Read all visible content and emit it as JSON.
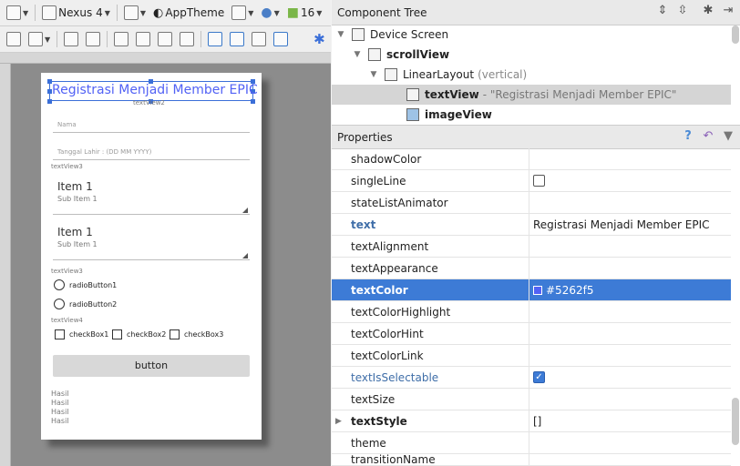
{
  "toolbar1": {
    "device": "Nexus 4",
    "theme": "AppTheme",
    "api": "16"
  },
  "device_preview": {
    "title": "Registrasi Menjadi Member EPIC",
    "title_color": "#5262f5",
    "textview2": "textView2",
    "nama_hint": "Nama",
    "tanggal_hint": "Tanggal Lahir : (DD MM YYYY)",
    "textview3a": "textView3",
    "spinner1": {
      "item": "Item 1",
      "sub": "Sub Item 1"
    },
    "spinner2": {
      "item": "Item 1",
      "sub": "Sub Item 1"
    },
    "textview3b": "textView3",
    "radio1": "radioButton1",
    "radio2": "radioButton2",
    "textview4": "textView4",
    "checkbox1": "checkBox1",
    "checkbox2": "checkBox2",
    "checkbox3": "checkBox3",
    "button": "button",
    "hasil": [
      "Hasil",
      "Hasil",
      "Hasil",
      "Hasil"
    ]
  },
  "component_tree": {
    "header": "Component Tree",
    "rows": [
      {
        "label": "Device Screen"
      },
      {
        "label": "scrollView"
      },
      {
        "label": "LinearLayout",
        "suffix": "(vertical)"
      },
      {
        "label": "textView",
        "suffix": "- \"Registrasi Menjadi Member EPIC\""
      },
      {
        "label": "imageView"
      }
    ]
  },
  "properties": {
    "header": "Properties",
    "rows": [
      {
        "name": "shadowColor",
        "value": ""
      },
      {
        "name": "singleLine",
        "value": ""
      },
      {
        "name": "stateListAnimator",
        "value": ""
      },
      {
        "name": "text",
        "value": "Registrasi Menjadi Member EPIC"
      },
      {
        "name": "textAlignment",
        "value": ""
      },
      {
        "name": "textAppearance",
        "value": ""
      },
      {
        "name": "textColor",
        "value": "#5262f5"
      },
      {
        "name": "textColorHighlight",
        "value": ""
      },
      {
        "name": "textColorHint",
        "value": ""
      },
      {
        "name": "textColorLink",
        "value": ""
      },
      {
        "name": "textIsSelectable",
        "value": ""
      },
      {
        "name": "textSize",
        "value": ""
      },
      {
        "name": "textStyle",
        "value": "[]"
      },
      {
        "name": "theme",
        "value": ""
      },
      {
        "name": "transitionName",
        "value": ""
      }
    ]
  },
  "colors": {
    "selection": "#3d7bd6",
    "text_color_swatch": "#5262f5"
  }
}
